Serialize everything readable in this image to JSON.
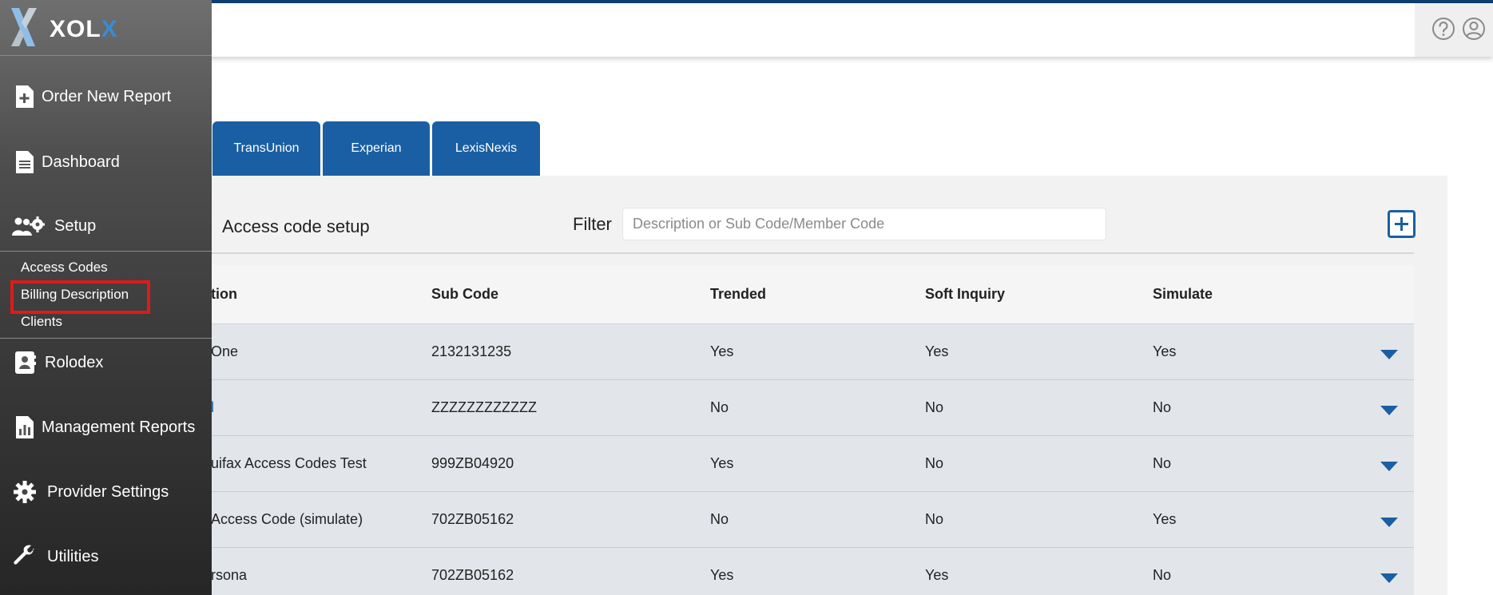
{
  "header": {
    "help_icon": "help-circle-icon",
    "user_icon": "user-circle-icon"
  },
  "sidebar": {
    "logo": {
      "text_main": "XOL",
      "text_accent": "X"
    },
    "nav": [
      {
        "label": "Order New Report",
        "icon": "file-plus-icon"
      },
      {
        "label": "Dashboard",
        "icon": "document-icon"
      },
      {
        "label": "Setup",
        "icon": "users-gear-icon"
      }
    ],
    "setup_sub": [
      {
        "label": "Access Codes"
      },
      {
        "label": "Billing Description"
      },
      {
        "label": "Clients"
      }
    ],
    "nav_lower": [
      {
        "label": "Rolodex",
        "icon": "contact-book-icon"
      },
      {
        "label": "Management Reports",
        "icon": "bar-chart-file-icon"
      },
      {
        "label": "Provider Settings",
        "icon": "gear-icon"
      },
      {
        "label": "Utilities",
        "icon": "wrench-icon"
      }
    ],
    "colors": {
      "highlight": "#e01a1a",
      "accent": "#3b8ad6"
    }
  },
  "tabs": [
    {
      "label": "TransUnion"
    },
    {
      "label": "Experian"
    },
    {
      "label": "LexisNexis"
    }
  ],
  "panel": {
    "title": "Access code setup",
    "filter_label": "Filter",
    "filter_placeholder": "Description or Sub Code/Member Code",
    "add_icon": "plus-square-icon",
    "columns": [
      "tion",
      "Sub Code",
      "Trended",
      "Soft Inquiry",
      "Simulate"
    ],
    "rows": [
      {
        "desc": "One",
        "sub": "2132131235",
        "trended": "Yes",
        "soft": "Yes",
        "simulate": "Yes"
      },
      {
        "desc": "l",
        "sub": "ZZZZZZZZZZZZ",
        "trended": "No",
        "soft": "No",
        "simulate": "No"
      },
      {
        "desc": "uifax Access Codes Test",
        "sub": "999ZB04920",
        "trended": "Yes",
        "soft": "No",
        "simulate": "No"
      },
      {
        "desc": "Access Code (simulate)",
        "sub": "702ZB05162",
        "trended": "No",
        "soft": "No",
        "simulate": "Yes"
      },
      {
        "desc": "rsona",
        "sub": "702ZB05162",
        "trended": "Yes",
        "soft": "Yes",
        "simulate": "No"
      }
    ]
  },
  "colors": {
    "brand": "#1a5fa3",
    "topline": "#0d3f72"
  }
}
